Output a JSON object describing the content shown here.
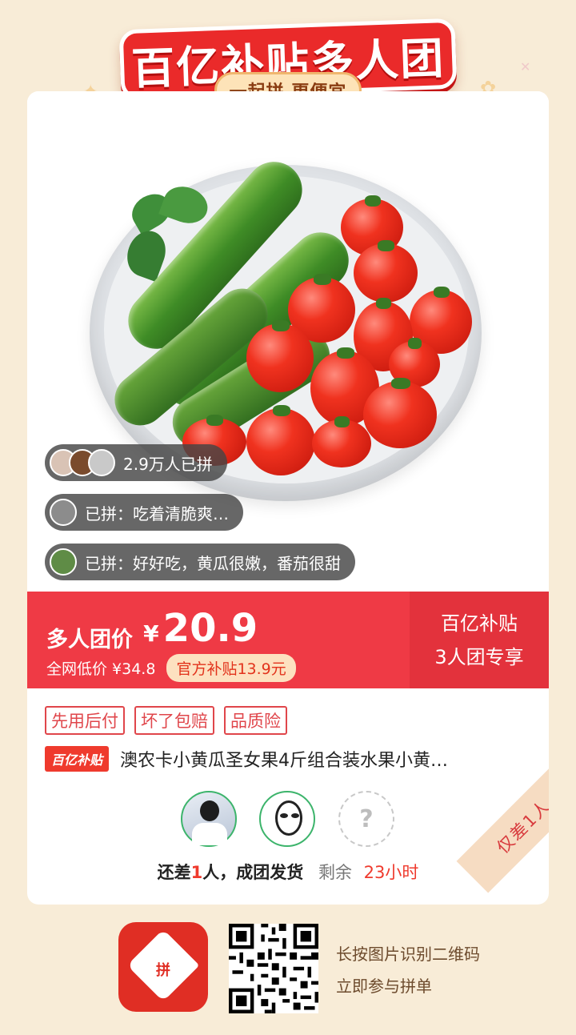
{
  "banner": {
    "title": "百亿补贴多人团",
    "subtitle": "一起拼 更便宜"
  },
  "product": {
    "social": {
      "joined_count": "2.9万人已拼",
      "review_1": "已拼：吃着清脆爽…",
      "review_2": "已拼：好好吃，黄瓜很嫩，番茄很甜"
    },
    "price": {
      "label": "多人团价",
      "currency": "¥",
      "amount": "20.9",
      "market_low": "全网低价 ¥34.8",
      "subsidy": "官方补贴13.9元"
    },
    "promo": {
      "line1": "百亿补贴",
      "line2": "3人团专享"
    },
    "tags": [
      "先用后付",
      "坏了包赔",
      "品质险"
    ],
    "title_badge": "百亿补贴",
    "title": "澳农卡小黄瓜圣女果4斤组合装水果小黄…"
  },
  "group": {
    "missing_placeholder": "?",
    "status_prefix": "还差",
    "status_count": "1",
    "status_suffix": "人，成团发货",
    "remaining_label": "剩余",
    "remaining_time": "23小时",
    "corner_badge": "仅差1人"
  },
  "footer": {
    "app_icon_label": "拼",
    "line1": "长按图片识别二维码",
    "line2": "立即参与拼单"
  },
  "colors": {
    "accent_red": "#ef3a45",
    "brand_red": "#e02e24",
    "background": "#f8ecd7"
  }
}
